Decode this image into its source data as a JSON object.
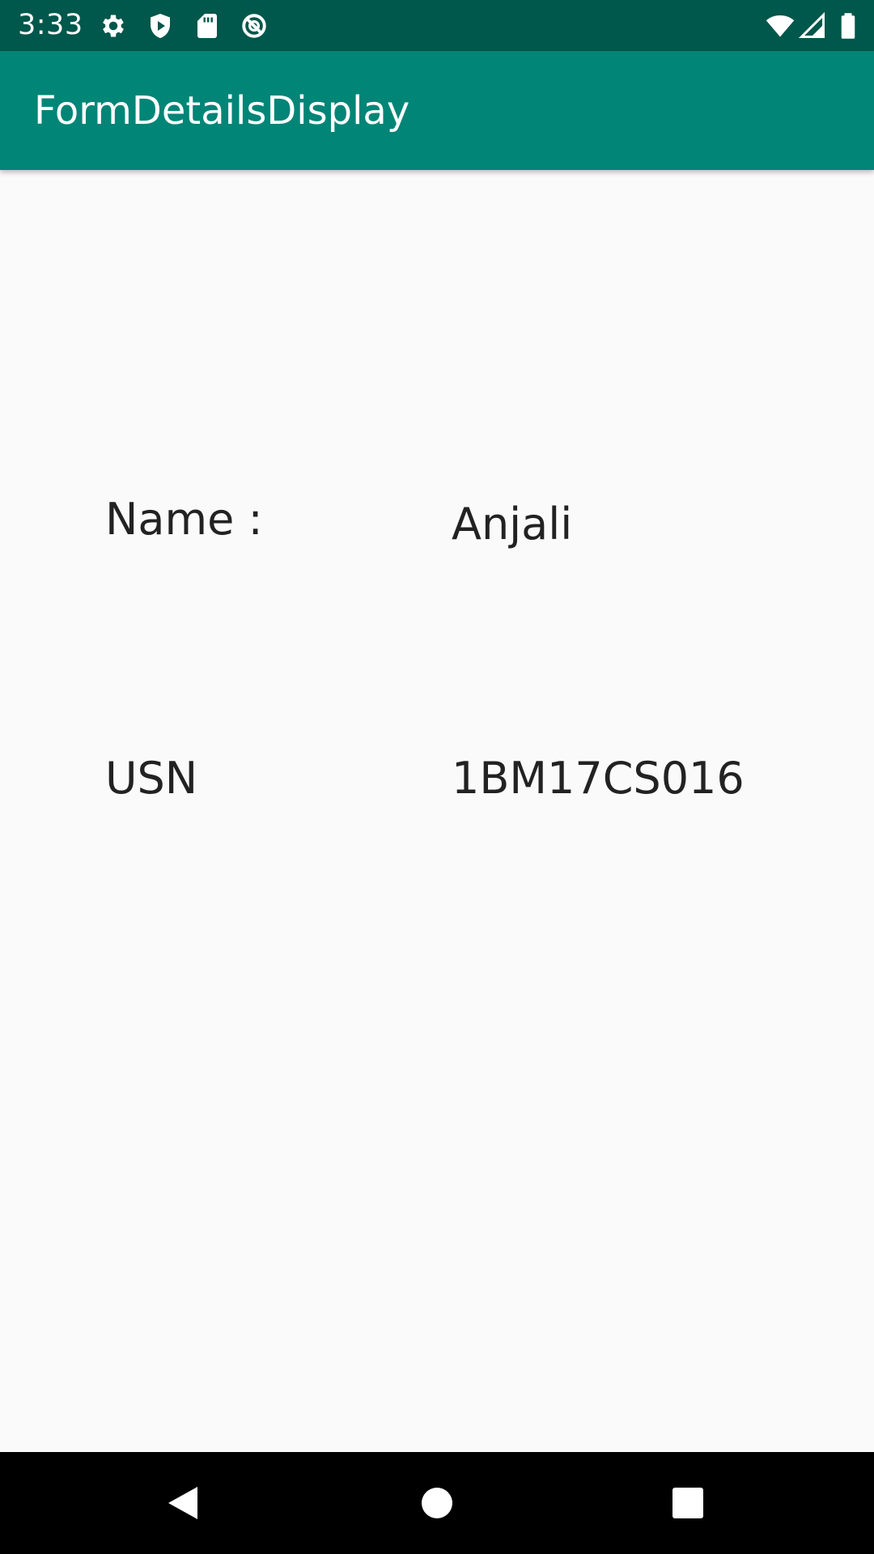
{
  "status_bar": {
    "time": "3:33",
    "icons_left": [
      "settings-gear-icon",
      "shield-play-icon",
      "sd-card-icon",
      "no-sync-icon"
    ],
    "icons_right": [
      "wifi-icon",
      "cellular-signal-icon",
      "battery-icon"
    ]
  },
  "app_bar": {
    "title": "FormDetailsDisplay"
  },
  "details": {
    "name_label": "Name :",
    "name_value": "Anjali",
    "usn_label": "USN",
    "usn_value": "1BM17CS016"
  },
  "nav_bar": {
    "buttons": [
      "back-icon",
      "home-icon",
      "recents-icon"
    ]
  },
  "colors": {
    "status_bar": "#00574b",
    "app_bar": "#008577",
    "background": "#fafafa",
    "text": "#222222",
    "nav_bar": "#000000"
  }
}
